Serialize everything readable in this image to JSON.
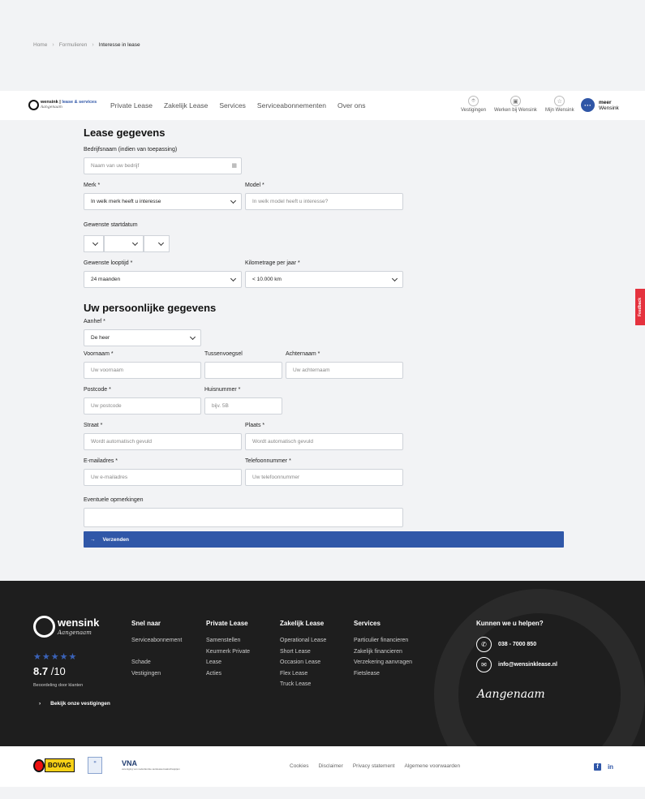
{
  "breadcrumb": [
    "Home",
    "Formulieren",
    "Interesse in lease"
  ],
  "header": {
    "logo_name": "wensink",
    "logo_sub": "lease & services",
    "logo_script": "Aangenaam",
    "nav": [
      "Private Lease",
      "Zakelijk Lease",
      "Services",
      "Serviceabonnementen",
      "Over ons"
    ],
    "icons": [
      {
        "label": "Vestigingen",
        "icon": "location-icon"
      },
      {
        "label": "Werken bij Wensink",
        "icon": "briefcase-icon"
      },
      {
        "label": "Mijn Wensink",
        "icon": "star-icon"
      }
    ],
    "meer": "meer",
    "meer_sub": "Wensink"
  },
  "form": {
    "lease_title": "Lease gegevens",
    "bedrijf_label": "Bedrijfsnaam (indien van toepassing)",
    "bedrijf_ph": "Naam van uw bedrijf",
    "merk_label": "Merk *",
    "merk_value": "In welk merk heeft u interesse",
    "model_label": "Model *",
    "model_ph": "In welk model heeft u interesse?",
    "startdatum_label": "Gewenste startdatum",
    "looptijd_label": "Gewenste looptijd *",
    "looptijd_value": "24 maanden",
    "km_label": "Kilometrage per jaar *",
    "km_value": "< 10.000 km",
    "personal_title": "Uw persoonlijke gegevens",
    "aanhef_label": "Aanhef *",
    "aanhef_value": "De heer",
    "voornaam_label": "Voornaam *",
    "voornaam_ph": "Uw voornaam",
    "tussen_label": "Tussenvoegsel",
    "achternaam_label": "Achternaam *",
    "achternaam_ph": "Uw achternaam",
    "postcode_label": "Postcode *",
    "postcode_ph": "Uw postcode",
    "huisnr_label": "Huisnummer *",
    "huisnr_ph": "bijv. 5B",
    "straat_label": "Straat *",
    "straat_ph": "Wordt automatisch gevuld",
    "plaats_label": "Plaats *",
    "plaats_ph": "Wordt automatisch gevuld",
    "email_label": "E-mailadres *",
    "email_ph": "Uw e-mailadres",
    "tel_label": "Telefoonnummer *",
    "tel_ph": "Uw telefoonnummer",
    "opm_label": "Eventuele opmerkingen",
    "submit": "Verzenden"
  },
  "feedback": "Feedback",
  "footer": {
    "logo_name": "wensink",
    "logo_script": "Aangenaam",
    "stars": "★★★★★",
    "score": "8.7",
    "score_max": "/10",
    "rating_text": "Beoordeling door klanten",
    "vestigingen": "Bekijk onze vestigingen",
    "cols": [
      {
        "title": "Snel naar",
        "items": [
          "Serviceabonnement",
          "",
          "Schade",
          "Vestigingen"
        ]
      },
      {
        "title": "Private Lease",
        "items": [
          "Samenstellen",
          "Keurmerk Private",
          "Lease",
          "Acties"
        ]
      },
      {
        "title": "Zakelijk Lease",
        "items": [
          "Operational Lease",
          "Short Lease",
          "Occasion Lease",
          "Flex Lease",
          "Truck Lease"
        ]
      },
      {
        "title": "Services",
        "items": [
          "Particulier financieren",
          "Zakelijk financieren",
          "Verzekering aanvragen",
          "Fietslease"
        ]
      }
    ],
    "help_title": "Kunnen we u helpen?",
    "phone": "038 - 7000 850",
    "email": "info@wensinklease.nl",
    "signature": "Aangenaam"
  },
  "bottom": {
    "bovag": "BOVAG",
    "vna": "VNA",
    "vna_sub": "vereniging van nederlandse autoleasemaatschappijen",
    "links": [
      "Cookies",
      "Disclaimer",
      "Privacy statement",
      "Algemene voorwaarden"
    ]
  }
}
